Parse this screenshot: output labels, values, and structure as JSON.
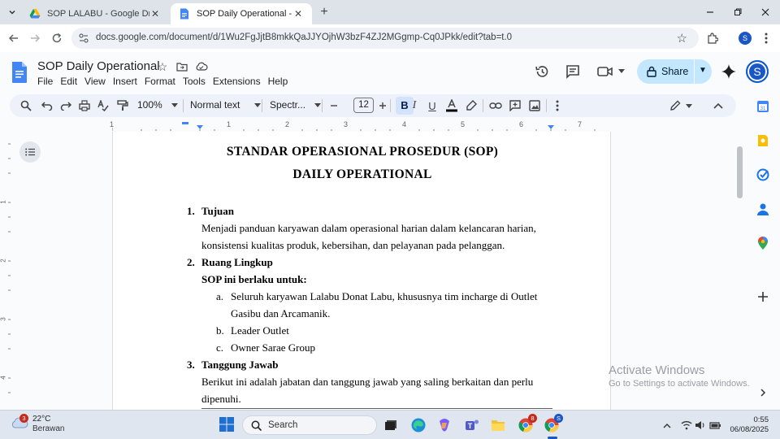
{
  "browser": {
    "tabs": [
      {
        "title": "SOP LALABU - Google Drive",
        "icon": "google-drive-icon",
        "active": false
      },
      {
        "title": "SOP Daily Operational - Google Docs",
        "icon": "google-docs-icon",
        "active": true
      }
    ],
    "url": "docs.google.com/document/d/1Wu2FgJjtB8mkkQaJJYOjhW3bzF4ZJ2MGgmp-Cq0JPkk/edit?tab=t.0",
    "profile_initial": "S"
  },
  "docs": {
    "title": "SOP Daily Operational",
    "menu": [
      "File",
      "Edit",
      "View",
      "Insert",
      "Format",
      "Tools",
      "Extensions",
      "Help"
    ],
    "share_label": "Share",
    "account_initial": "S"
  },
  "toolbar": {
    "zoom": "100%",
    "style": "Normal text",
    "font": "Spectr...",
    "font_size": "12",
    "bold": "B",
    "italic": "I",
    "underline": "U"
  },
  "ruler": {
    "numbers": [
      "1",
      "1",
      "2",
      "3",
      "4",
      "5",
      "6",
      "7"
    ],
    "vertical_numbers": [
      "1",
      "2",
      "3",
      "4"
    ]
  },
  "document": {
    "heading1": "STANDAR OPERASIONAL PROSEDUR (SOP)",
    "heading2": "DAILY OPERATIONAL",
    "s1_num": "1.",
    "s1_title": "Tujuan",
    "s1_line1": "Menjadi panduan karyawan dalam operasional harian dalam kelancaran harian,",
    "s1_line2": "konsistensi kualitas produk, kebersihan, dan pelayanan pada pelanggan.",
    "s2_num": "2.",
    "s2_title": "Ruang Lingkup",
    "s2_sub": "SOP ini berlaku untuk:",
    "s2_a_num": "a.",
    "s2_a_line1": "Seluruh karyawan Lalabu Donat Labu, khususnya tim incharge di Outlet",
    "s2_a_line2": "Gasibu dan Arcamanik.",
    "s2_b_num": "b.",
    "s2_b": "Leader Outlet",
    "s2_c_num": "c.",
    "s2_c": "Owner Sarae Group",
    "s3_num": "3.",
    "s3_title": "Tanggung Jawab",
    "s3_line1": "Berikut ini adalah jabatan dan tanggung jawab yang saling berkaitan dan perlu",
    "s3_line2": "dipenuhi."
  },
  "watermark": {
    "line1": "Activate Windows",
    "line2": "Go to Settings to activate Windows."
  },
  "taskbar": {
    "weather_badge": "3",
    "temperature": "22°C",
    "condition": "Berawan",
    "search_placeholder": "Search",
    "chrome_badge": "8",
    "chrome_profile": "S",
    "time": "0:55",
    "date": "06/08/2025"
  },
  "colors": {
    "accent": "#0b57d0",
    "share_bg": "#c2e7ff",
    "toolbar_bg": "#edf2fa",
    "tab_strip": "#dee3ea"
  }
}
